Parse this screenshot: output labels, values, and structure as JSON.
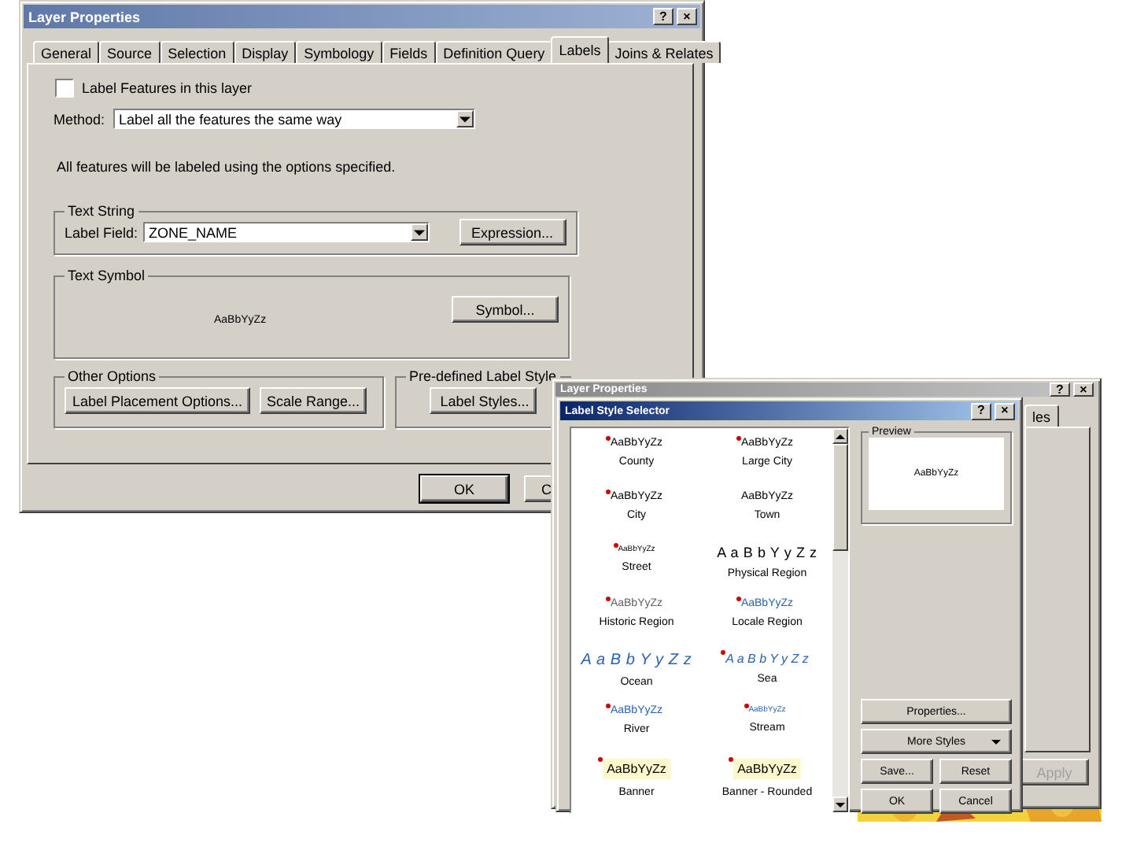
{
  "main_dialog": {
    "title": "Layer Properties",
    "title_buttons": [
      "?",
      "×"
    ],
    "tabs": [
      {
        "label": "General",
        "selected": false
      },
      {
        "label": "Source",
        "selected": false
      },
      {
        "label": "Selection",
        "selected": false
      },
      {
        "label": "Display",
        "selected": false
      },
      {
        "label": "Symbology",
        "selected": false
      },
      {
        "label": "Fields",
        "selected": false
      },
      {
        "label": "Definition Query",
        "selected": false
      },
      {
        "label": "Labels",
        "selected": true
      },
      {
        "label": "Joins & Relates",
        "selected": false
      }
    ],
    "label_features": {
      "label": "Label Features in this layer",
      "checked": false
    },
    "method": {
      "label": "Method:",
      "value": "Label all the features the same way"
    },
    "note": "All features will be labeled using the options specified.",
    "text_string": {
      "title": "Text String",
      "field_label": "Label Field:",
      "field_value": "ZONE_NAME",
      "button": "Expression..."
    },
    "text_symbol": {
      "title": "Text Symbol",
      "sample": "AaBbYyZz",
      "button": "Symbol..."
    },
    "other_options": {
      "title": "Other Options",
      "buttons": [
        "Label Placement Options...",
        "Scale Range..."
      ]
    },
    "predefined": {
      "title": "Pre-defined Label Style",
      "buttons": [
        "Label Styles..."
      ]
    },
    "buttons": [
      "OK",
      "C"
    ]
  },
  "back_window": {
    "title": "Layer Properties",
    "title_buttons": [
      "?",
      "×"
    ],
    "tab_fragment": "les",
    "apply": {
      "label": "Apply",
      "disabled": true
    }
  },
  "selector": {
    "title": "Label Style Selector",
    "title_buttons": [
      "?",
      "×"
    ],
    "styles": [
      {
        "sample": "AaBbYyZz",
        "name": "County",
        "kind": "plain",
        "marked": true
      },
      {
        "sample": "AaBbYyZz",
        "name": "Large City",
        "kind": "plain",
        "marked": true
      },
      {
        "sample": "AaBbYyZz",
        "name": "City",
        "kind": "plain",
        "marked": true
      },
      {
        "sample": "AaBbYyZz",
        "name": "Town",
        "kind": "plain",
        "marked": false
      },
      {
        "sample": "AaBbYyZz",
        "name": "Street",
        "kind": "tiny",
        "marked": true
      },
      {
        "sample": "A a B b Y y Z z",
        "name": "Physical Region",
        "kind": "spaced",
        "marked": false
      },
      {
        "sample": "AaBbYyZz",
        "name": "Historic Region",
        "kind": "grey",
        "marked": true
      },
      {
        "sample": "AaBbYyZz",
        "name": "Locale Region",
        "kind": "blue",
        "marked": true
      },
      {
        "sample": "A a B b Y y Z z",
        "name": "Ocean",
        "kind": "blue-large",
        "marked": false
      },
      {
        "sample": "A a B b Y y Z z",
        "name": "Sea",
        "kind": "blue-spaced",
        "marked": true
      },
      {
        "sample": "AaBbYyZz",
        "name": "River",
        "kind": "blue",
        "marked": true
      },
      {
        "sample": "AaBbYyZz",
        "name": "Stream",
        "kind": "blue-tiny",
        "marked": true
      },
      {
        "sample": "AaBbYyZz",
        "name": "Banner",
        "kind": "banner",
        "marked": true
      },
      {
        "sample": "AaBbYyZz",
        "name": "Banner - Rounded",
        "kind": "banner",
        "marked": true
      }
    ],
    "preview": {
      "title": "Preview",
      "sample": "AaBbYyZz"
    },
    "button_rows": [
      [
        {
          "label": "Properties...",
          "kind": "button"
        }
      ],
      [
        {
          "label": "More Styles",
          "kind": "dropdown"
        }
      ],
      [
        {
          "label": "Save...",
          "kind": "button"
        },
        {
          "label": "Reset",
          "kind": "button"
        }
      ],
      [
        {
          "label": "OK",
          "kind": "button"
        },
        {
          "label": "Cancel",
          "kind": "button"
        }
      ]
    ]
  }
}
